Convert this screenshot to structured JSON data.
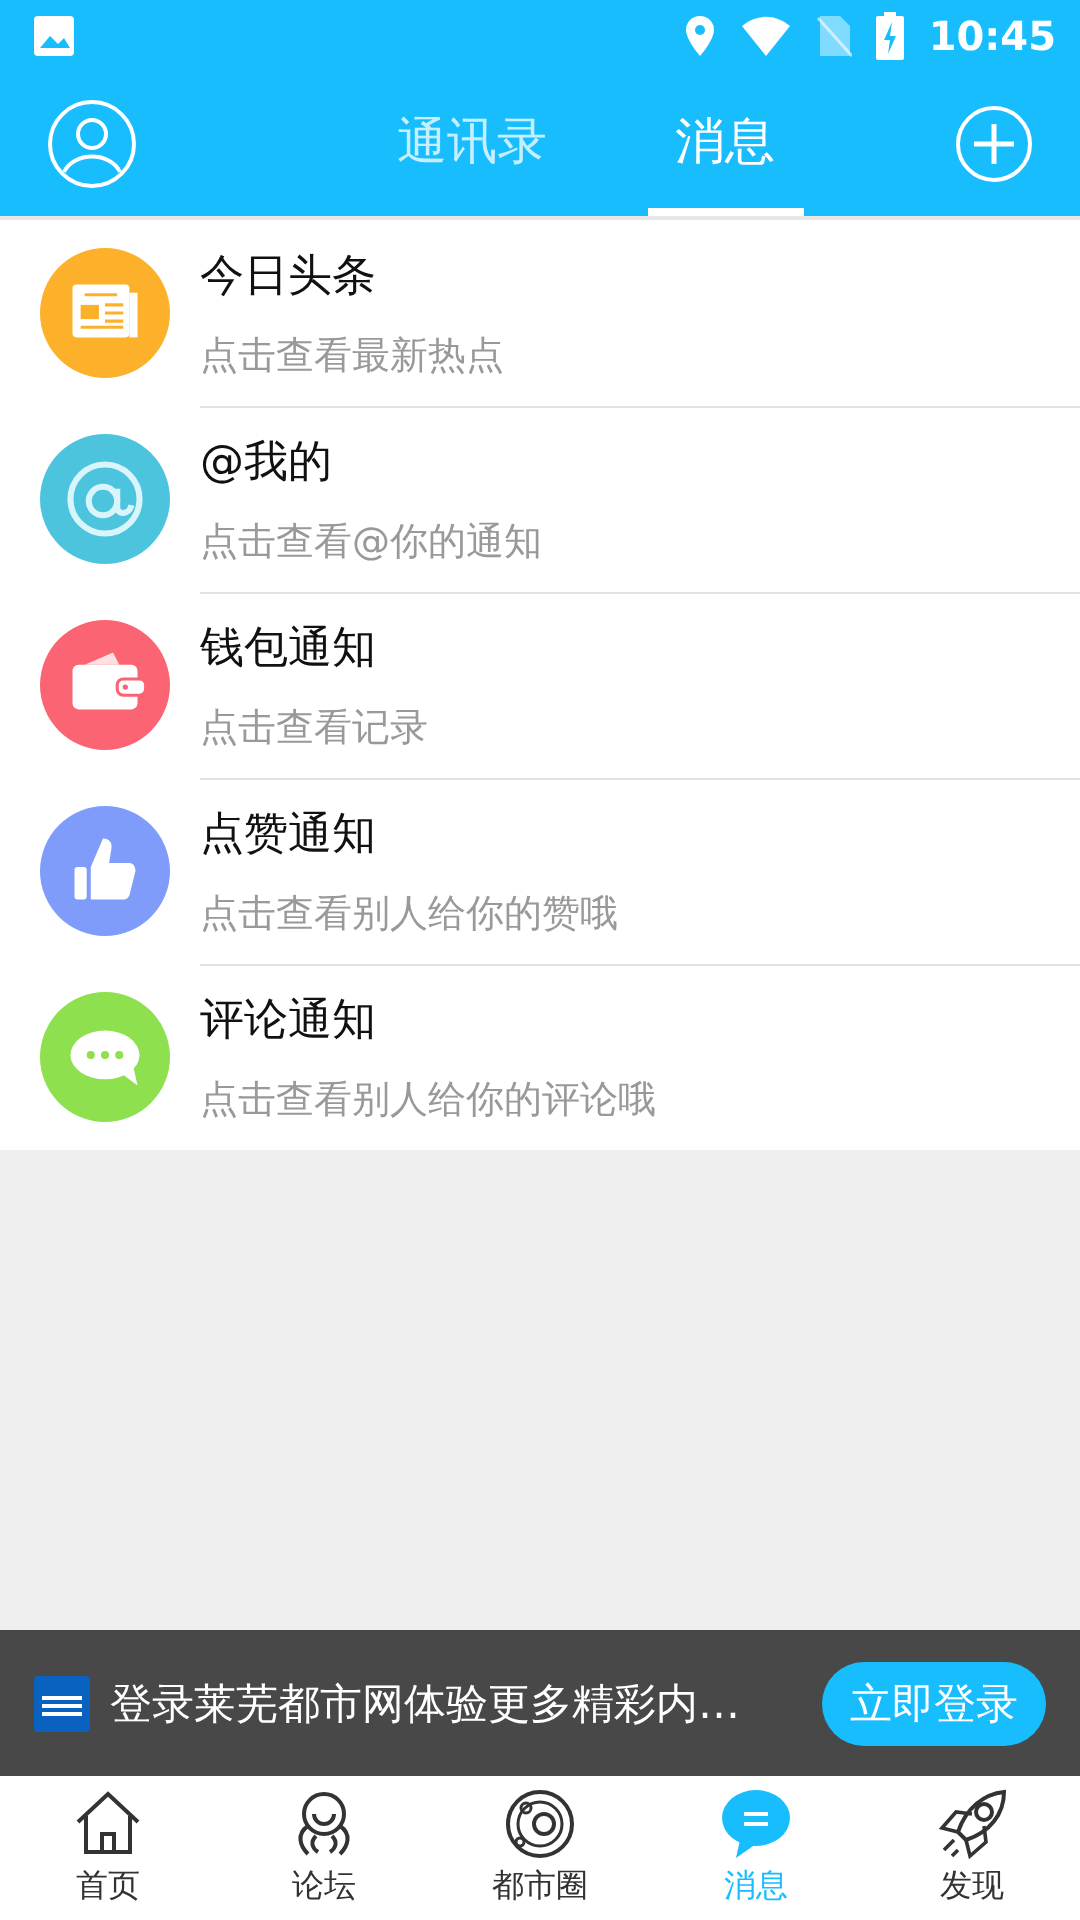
{
  "status_bar": {
    "time": "10:45"
  },
  "header": {
    "tabs": [
      {
        "label": "通讯录",
        "selected": false
      },
      {
        "label": "消息",
        "selected": true
      }
    ]
  },
  "messages": [
    {
      "kind": "news",
      "title": "今日头条",
      "subtitle": "点击查看最新热点",
      "color": "#fdb12b"
    },
    {
      "kind": "mention",
      "title": "@我的",
      "subtitle": "点击查看@你的通知",
      "color": "#4cc4dd"
    },
    {
      "kind": "wallet",
      "title": "钱包通知",
      "subtitle": "点击查看记录",
      "color": "#fb6472"
    },
    {
      "kind": "like",
      "title": "点赞通知",
      "subtitle": "点击查看别人给你的赞哦",
      "color": "#7f9cfb"
    },
    {
      "kind": "comment",
      "title": "评论通知",
      "subtitle": "点击查看别人给你的评论哦",
      "color": "#8ee04f"
    }
  ],
  "login_banner": {
    "text": "登录莱芜都市网体验更多精彩内…",
    "button": "立即登录"
  },
  "bottom_nav": [
    {
      "kind": "home",
      "label": "首页",
      "selected": false
    },
    {
      "kind": "forum",
      "label": "论坛",
      "selected": false
    },
    {
      "kind": "circle",
      "label": "都市圈",
      "selected": false
    },
    {
      "kind": "message",
      "label": "消息",
      "selected": true
    },
    {
      "kind": "discover",
      "label": "发现",
      "selected": false
    }
  ]
}
